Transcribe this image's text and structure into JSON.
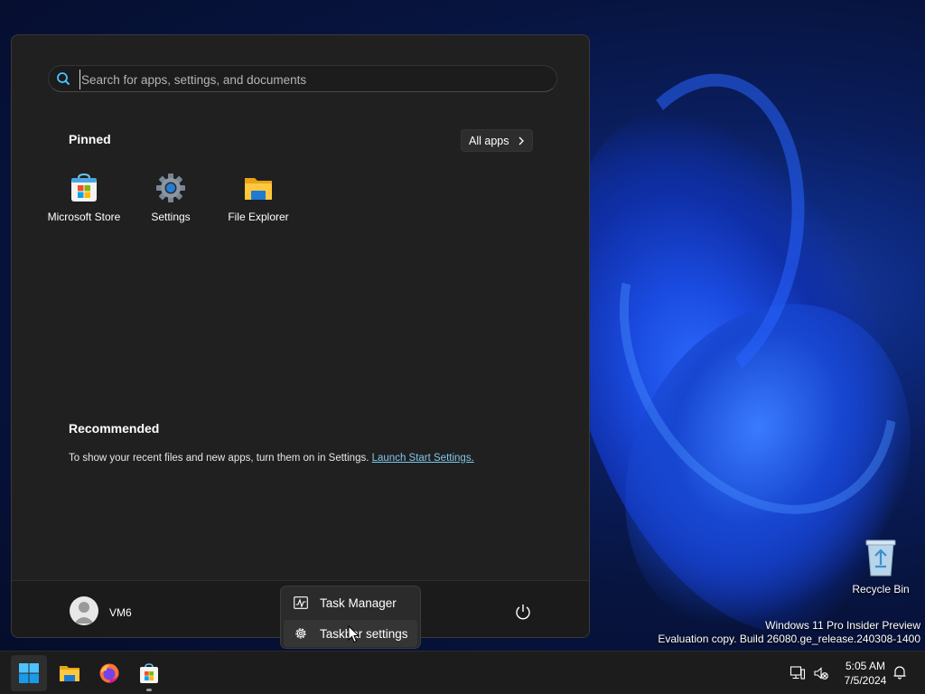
{
  "search": {
    "placeholder": "Search for apps, settings, and documents"
  },
  "pinned": {
    "title": "Pinned",
    "all_apps_label": "All apps",
    "apps": [
      {
        "label": "Microsoft Store",
        "icon": "microsoft-store-icon"
      },
      {
        "label": "Settings",
        "icon": "settings-gear-icon"
      },
      {
        "label": "File Explorer",
        "icon": "folder-icon"
      }
    ]
  },
  "recommended": {
    "title": "Recommended",
    "text": "To show your recent files and new apps, turn them on in Settings. ",
    "link": "Launch Start Settings."
  },
  "footer": {
    "user_name": "VM6"
  },
  "context_menu": {
    "items": [
      {
        "label": "Task Manager",
        "icon": "task-manager-icon"
      },
      {
        "label": "Taskbar settings",
        "icon": "gear-icon"
      }
    ]
  },
  "desktop": {
    "recycle_bin_label": "Recycle Bin",
    "watermark_line1": "Windows 11 Pro Insider Preview",
    "watermark_line2": "Evaluation copy. Build 26080.ge_release.240308-1400"
  },
  "taskbar": {
    "apps": [
      "start-icon",
      "file-explorer-icon",
      "firefox-icon",
      "microsoft-store-icon"
    ],
    "time": "5:05 AM",
    "date": "7/5/2024"
  },
  "colors": {
    "accent": "#0078d4",
    "link": "#7fc6ea",
    "menu_bg": "#202020"
  }
}
